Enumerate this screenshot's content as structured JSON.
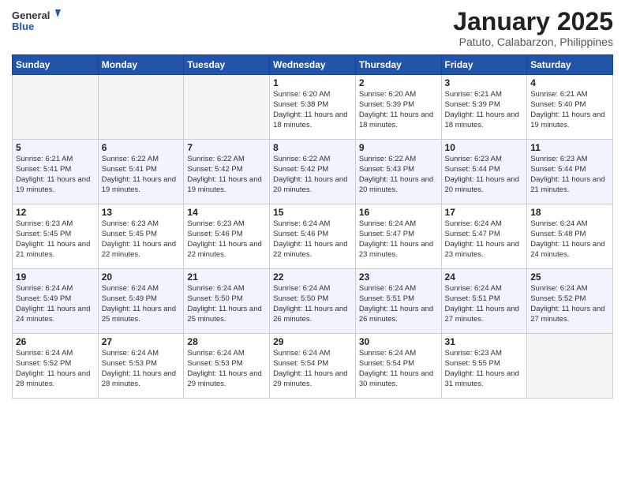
{
  "header": {
    "logo_general": "General",
    "logo_blue": "Blue",
    "month_title": "January 2025",
    "location": "Patuto, Calabarzon, Philippines"
  },
  "days_of_week": [
    "Sunday",
    "Monday",
    "Tuesday",
    "Wednesday",
    "Thursday",
    "Friday",
    "Saturday"
  ],
  "weeks": [
    [
      {
        "day": "",
        "info": ""
      },
      {
        "day": "",
        "info": ""
      },
      {
        "day": "",
        "info": ""
      },
      {
        "day": "1",
        "info": "Sunrise: 6:20 AM\nSunset: 5:38 PM\nDaylight: 11 hours and 18 minutes."
      },
      {
        "day": "2",
        "info": "Sunrise: 6:20 AM\nSunset: 5:39 PM\nDaylight: 11 hours and 18 minutes."
      },
      {
        "day": "3",
        "info": "Sunrise: 6:21 AM\nSunset: 5:39 PM\nDaylight: 11 hours and 18 minutes."
      },
      {
        "day": "4",
        "info": "Sunrise: 6:21 AM\nSunset: 5:40 PM\nDaylight: 11 hours and 19 minutes."
      }
    ],
    [
      {
        "day": "5",
        "info": "Sunrise: 6:21 AM\nSunset: 5:41 PM\nDaylight: 11 hours and 19 minutes."
      },
      {
        "day": "6",
        "info": "Sunrise: 6:22 AM\nSunset: 5:41 PM\nDaylight: 11 hours and 19 minutes."
      },
      {
        "day": "7",
        "info": "Sunrise: 6:22 AM\nSunset: 5:42 PM\nDaylight: 11 hours and 19 minutes."
      },
      {
        "day": "8",
        "info": "Sunrise: 6:22 AM\nSunset: 5:42 PM\nDaylight: 11 hours and 20 minutes."
      },
      {
        "day": "9",
        "info": "Sunrise: 6:22 AM\nSunset: 5:43 PM\nDaylight: 11 hours and 20 minutes."
      },
      {
        "day": "10",
        "info": "Sunrise: 6:23 AM\nSunset: 5:44 PM\nDaylight: 11 hours and 20 minutes."
      },
      {
        "day": "11",
        "info": "Sunrise: 6:23 AM\nSunset: 5:44 PM\nDaylight: 11 hours and 21 minutes."
      }
    ],
    [
      {
        "day": "12",
        "info": "Sunrise: 6:23 AM\nSunset: 5:45 PM\nDaylight: 11 hours and 21 minutes."
      },
      {
        "day": "13",
        "info": "Sunrise: 6:23 AM\nSunset: 5:45 PM\nDaylight: 11 hours and 22 minutes."
      },
      {
        "day": "14",
        "info": "Sunrise: 6:23 AM\nSunset: 5:46 PM\nDaylight: 11 hours and 22 minutes."
      },
      {
        "day": "15",
        "info": "Sunrise: 6:24 AM\nSunset: 5:46 PM\nDaylight: 11 hours and 22 minutes."
      },
      {
        "day": "16",
        "info": "Sunrise: 6:24 AM\nSunset: 5:47 PM\nDaylight: 11 hours and 23 minutes."
      },
      {
        "day": "17",
        "info": "Sunrise: 6:24 AM\nSunset: 5:47 PM\nDaylight: 11 hours and 23 minutes."
      },
      {
        "day": "18",
        "info": "Sunrise: 6:24 AM\nSunset: 5:48 PM\nDaylight: 11 hours and 24 minutes."
      }
    ],
    [
      {
        "day": "19",
        "info": "Sunrise: 6:24 AM\nSunset: 5:49 PM\nDaylight: 11 hours and 24 minutes."
      },
      {
        "day": "20",
        "info": "Sunrise: 6:24 AM\nSunset: 5:49 PM\nDaylight: 11 hours and 25 minutes."
      },
      {
        "day": "21",
        "info": "Sunrise: 6:24 AM\nSunset: 5:50 PM\nDaylight: 11 hours and 25 minutes."
      },
      {
        "day": "22",
        "info": "Sunrise: 6:24 AM\nSunset: 5:50 PM\nDaylight: 11 hours and 26 minutes."
      },
      {
        "day": "23",
        "info": "Sunrise: 6:24 AM\nSunset: 5:51 PM\nDaylight: 11 hours and 26 minutes."
      },
      {
        "day": "24",
        "info": "Sunrise: 6:24 AM\nSunset: 5:51 PM\nDaylight: 11 hours and 27 minutes."
      },
      {
        "day": "25",
        "info": "Sunrise: 6:24 AM\nSunset: 5:52 PM\nDaylight: 11 hours and 27 minutes."
      }
    ],
    [
      {
        "day": "26",
        "info": "Sunrise: 6:24 AM\nSunset: 5:52 PM\nDaylight: 11 hours and 28 minutes."
      },
      {
        "day": "27",
        "info": "Sunrise: 6:24 AM\nSunset: 5:53 PM\nDaylight: 11 hours and 28 minutes."
      },
      {
        "day": "28",
        "info": "Sunrise: 6:24 AM\nSunset: 5:53 PM\nDaylight: 11 hours and 29 minutes."
      },
      {
        "day": "29",
        "info": "Sunrise: 6:24 AM\nSunset: 5:54 PM\nDaylight: 11 hours and 29 minutes."
      },
      {
        "day": "30",
        "info": "Sunrise: 6:24 AM\nSunset: 5:54 PM\nDaylight: 11 hours and 30 minutes."
      },
      {
        "day": "31",
        "info": "Sunrise: 6:23 AM\nSunset: 5:55 PM\nDaylight: 11 hours and 31 minutes."
      },
      {
        "day": "",
        "info": ""
      }
    ]
  ]
}
